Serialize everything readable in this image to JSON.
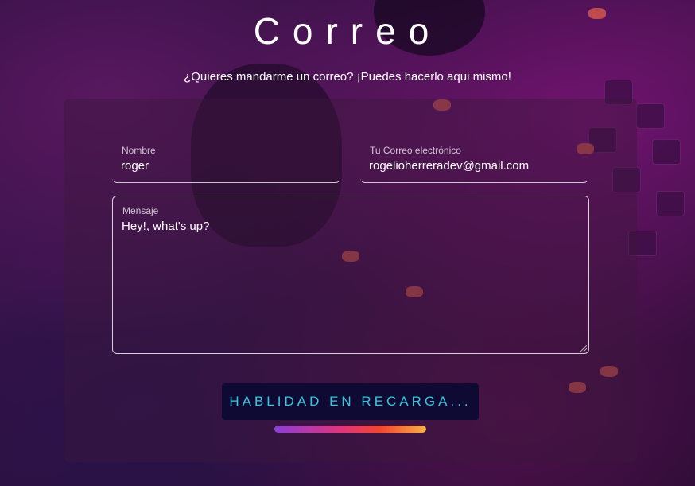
{
  "header": {
    "title": "Correo",
    "subtitle": "¿Quieres mandarme un correo? ¡Puedes hacerlo aqui mismo!"
  },
  "form": {
    "name": {
      "label": "Nombre",
      "value": "roger"
    },
    "email": {
      "label": "Tu Correo electrónico",
      "value": "rogelioherreradev@gmail.com"
    },
    "message": {
      "label": "Mensaje",
      "value": "Hey!, what's up?"
    },
    "submit_label": "HABLIDAD EN RECARGA...",
    "recharge_progress": 1.0
  },
  "colors": {
    "button_bg": "#0f0a33",
    "button_text": "#37c6dc",
    "progress_gradient": [
      "#8a3fd6",
      "#e0357a",
      "#f2462e",
      "#f6b04a"
    ]
  }
}
